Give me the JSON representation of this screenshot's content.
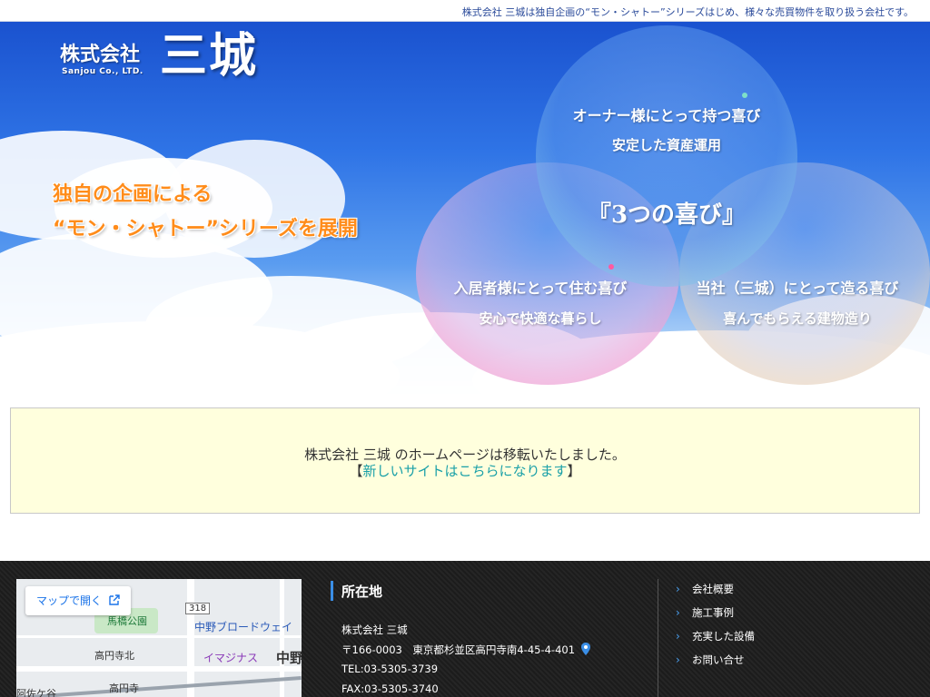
{
  "topbar": {
    "tagline": "株式会社 三城は独自企画の“モン・シャトー”シリーズはじめ、様々な売買物件を取り扱う会社です。"
  },
  "logo": {
    "prefix": "株式会社",
    "english": "Sanjou Co., LTD.",
    "name": "三城"
  },
  "catch": {
    "line1": "独自の企画による",
    "line2": "“モン・シャトー”シリーズを展開"
  },
  "joy": {
    "owner_line1": "オーナー様にとって持つ喜び",
    "owner_line2": "安定した資産運用",
    "center": "『3つの喜び』",
    "tenant_line1": "入居者様にとって住む喜び",
    "tenant_line2": "安心で快適な暮らし",
    "company_line1": "当社（三城）にとって造る喜び",
    "company_line2": "喜んでもらえる建物造り"
  },
  "colors": {
    "sky_blue": "#2f74e6",
    "catch_orange": "#ff8c1a",
    "link_teal": "#1aa0a8",
    "notice_bg": "#ffffdd",
    "footer_bg": "#1c1c1c",
    "accent_blue": "#3a8ee6"
  },
  "notice": {
    "message": "株式会社 三城 のホームページは移転いたしました。",
    "bracket_open": "【",
    "link_text": "新しいサイトはこちらになります",
    "bracket_close": "】"
  },
  "map": {
    "open_label": "マップで開く",
    "labels": [
      "馬橋公園",
      "中野ブロードウェイ",
      "高円寺北",
      "イマジナス",
      "中野",
      "高円寺",
      "阿佐ケ谷",
      "318"
    ]
  },
  "address": {
    "title": "所在地",
    "company": "株式会社 三城",
    "postal": "〒166-0003　東京都杉並区高円寺南4-45-4-401",
    "tel": "TEL:03-5305-3739",
    "fax": "FAX:03-5305-3740"
  },
  "footer_nav": [
    "会社概要",
    "施工事例",
    "充実した設備",
    "お問い合せ"
  ]
}
